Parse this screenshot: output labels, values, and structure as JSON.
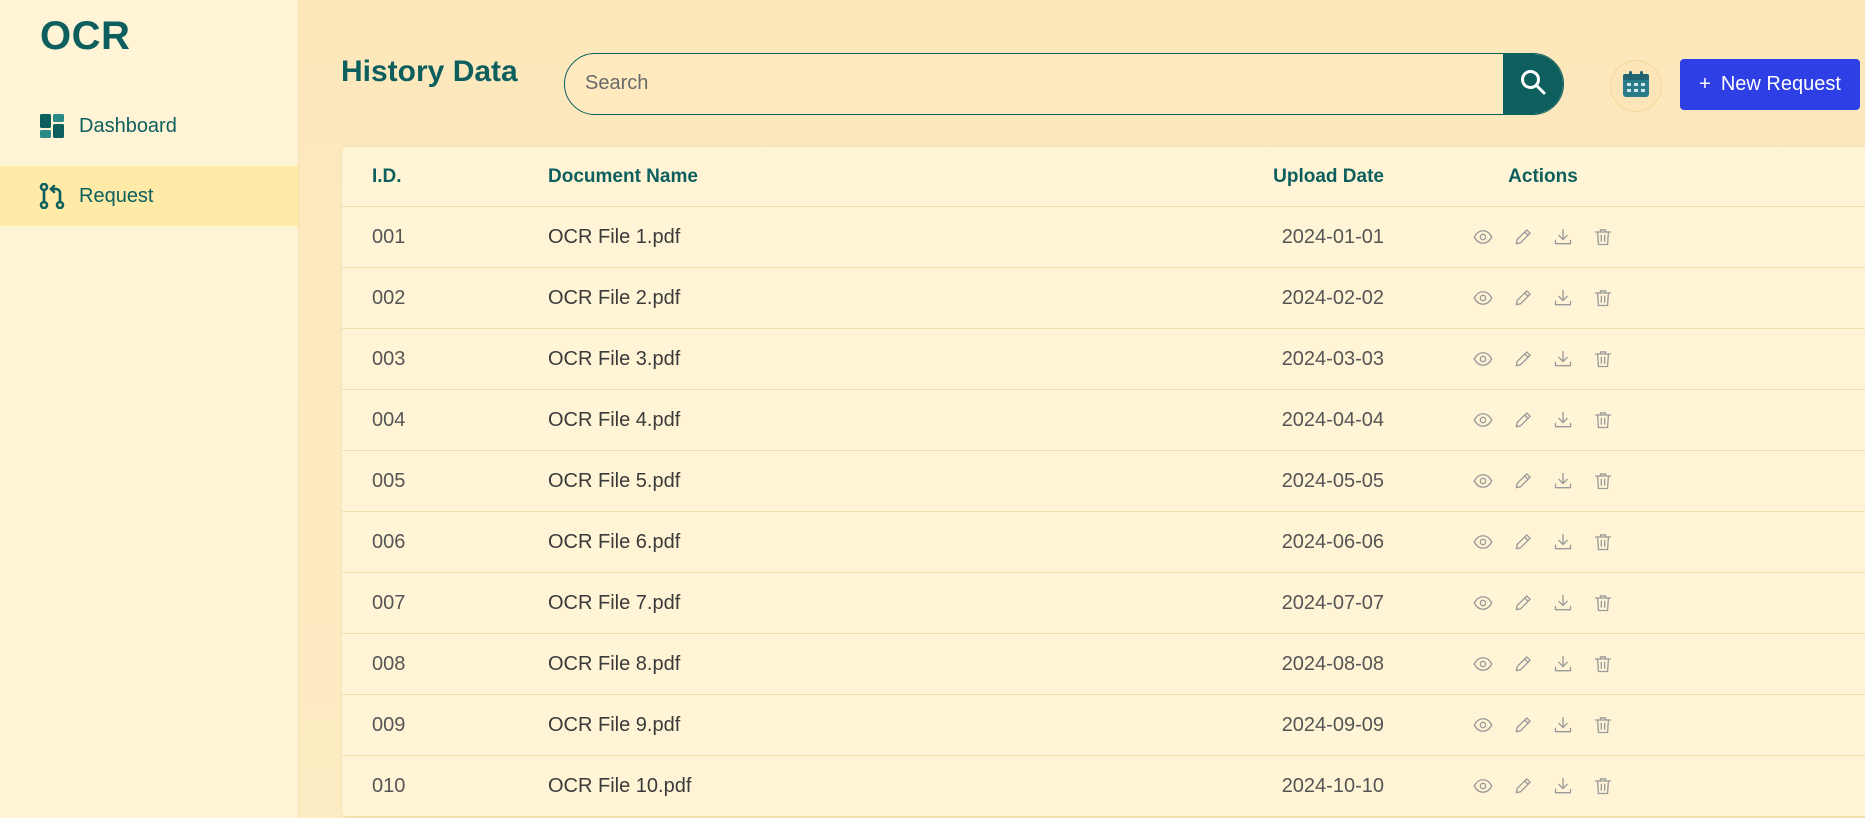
{
  "app": {
    "logo": "OCR"
  },
  "sidebar": {
    "items": [
      {
        "label": "Dashboard",
        "icon": "dashboard-icon"
      },
      {
        "label": "Request",
        "icon": "git-pull-request-icon",
        "active": true
      }
    ]
  },
  "header": {
    "title": "History Data",
    "search_placeholder": "Search",
    "new_request_label": "New Request",
    "new_request_icon": "+"
  },
  "colors": {
    "primary": "#0d5f5e",
    "accent_button": "#2e3fe6",
    "background": "#fdebbf",
    "sidebar_bg": "#fff5d6"
  },
  "table": {
    "columns": [
      "I.D.",
      "Document Name",
      "Upload Date",
      "Actions"
    ],
    "rows": [
      {
        "id": "001",
        "name": "OCR File 1.pdf",
        "date": "2024-01-01"
      },
      {
        "id": "002",
        "name": "OCR File 2.pdf",
        "date": "2024-02-02"
      },
      {
        "id": "003",
        "name": "OCR File 3.pdf",
        "date": "2024-03-03"
      },
      {
        "id": "004",
        "name": "OCR File 4.pdf",
        "date": "2024-04-04"
      },
      {
        "id": "005",
        "name": "OCR File 5.pdf",
        "date": "2024-05-05"
      },
      {
        "id": "006",
        "name": "OCR File 6.pdf",
        "date": "2024-06-06"
      },
      {
        "id": "007",
        "name": "OCR File 7.pdf",
        "date": "2024-07-07"
      },
      {
        "id": "008",
        "name": "OCR File 8.pdf",
        "date": "2024-08-08"
      },
      {
        "id": "009",
        "name": "OCR File 9.pdf",
        "date": "2024-09-09"
      },
      {
        "id": "010",
        "name": "OCR File 10.pdf",
        "date": "2024-10-10"
      }
    ],
    "action_icons": [
      "eye-icon",
      "pencil-icon",
      "download-icon",
      "trash-icon"
    ]
  }
}
